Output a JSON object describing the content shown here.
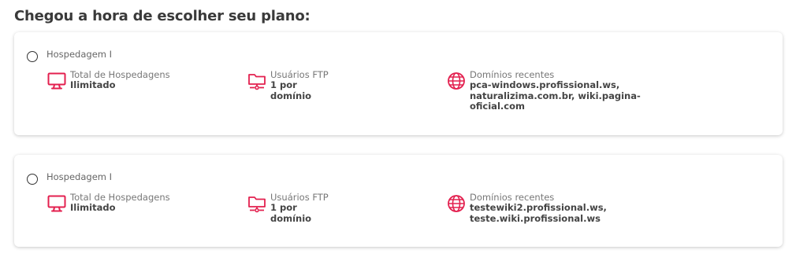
{
  "page": {
    "title": "Chegou a hora de escolher seu plano:"
  },
  "accent_color": "#e3204f",
  "plans": [
    {
      "name": "Hospedagem I",
      "selected": false,
      "features": [
        {
          "icon": "monitor-icon",
          "label": "Total de Hospedagens",
          "value": "Ilimitado"
        },
        {
          "icon": "folder-network-icon",
          "label": "Usuários FTP",
          "value": "1 por domínio"
        },
        {
          "icon": "globe-icon",
          "label": "Domínios recentes",
          "value": "pca-windows.profissional.ws, naturalizima.com.br, wiki.pagina-oficial.com"
        }
      ]
    },
    {
      "name": "Hospedagem I",
      "selected": false,
      "features": [
        {
          "icon": "monitor-icon",
          "label": "Total de Hospedagens",
          "value": "Ilimitado"
        },
        {
          "icon": "folder-network-icon",
          "label": "Usuários FTP",
          "value": "1 por domínio"
        },
        {
          "icon": "globe-icon",
          "label": "Domínios recentes",
          "value": "testewiki2.profissional.ws, teste.wiki.profissional.ws"
        }
      ]
    }
  ]
}
